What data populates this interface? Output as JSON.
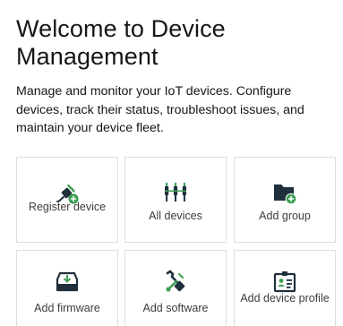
{
  "page": {
    "title": "Welcome to Device Management",
    "description": "Manage and monitor your IoT devices. Configure devices, track their status, troubleshoot issues, and maintain your device fleet."
  },
  "tiles": [
    {
      "label": "Register device",
      "icon": "plug-add-icon"
    },
    {
      "label": "All devices",
      "icon": "devices-icon"
    },
    {
      "label": "Add group",
      "icon": "folder-add-icon"
    },
    {
      "label": "Add firmware",
      "icon": "download-tray-icon"
    },
    {
      "label": "Add software",
      "icon": "software-tools-icon"
    },
    {
      "label": "Add device profile",
      "icon": "profile-card-icon"
    }
  ],
  "colors": {
    "icon_dark": "#1f2f3c",
    "icon_green": "#3fa055",
    "tile_border": "#dedede",
    "label_text": "#3d3d3d"
  }
}
